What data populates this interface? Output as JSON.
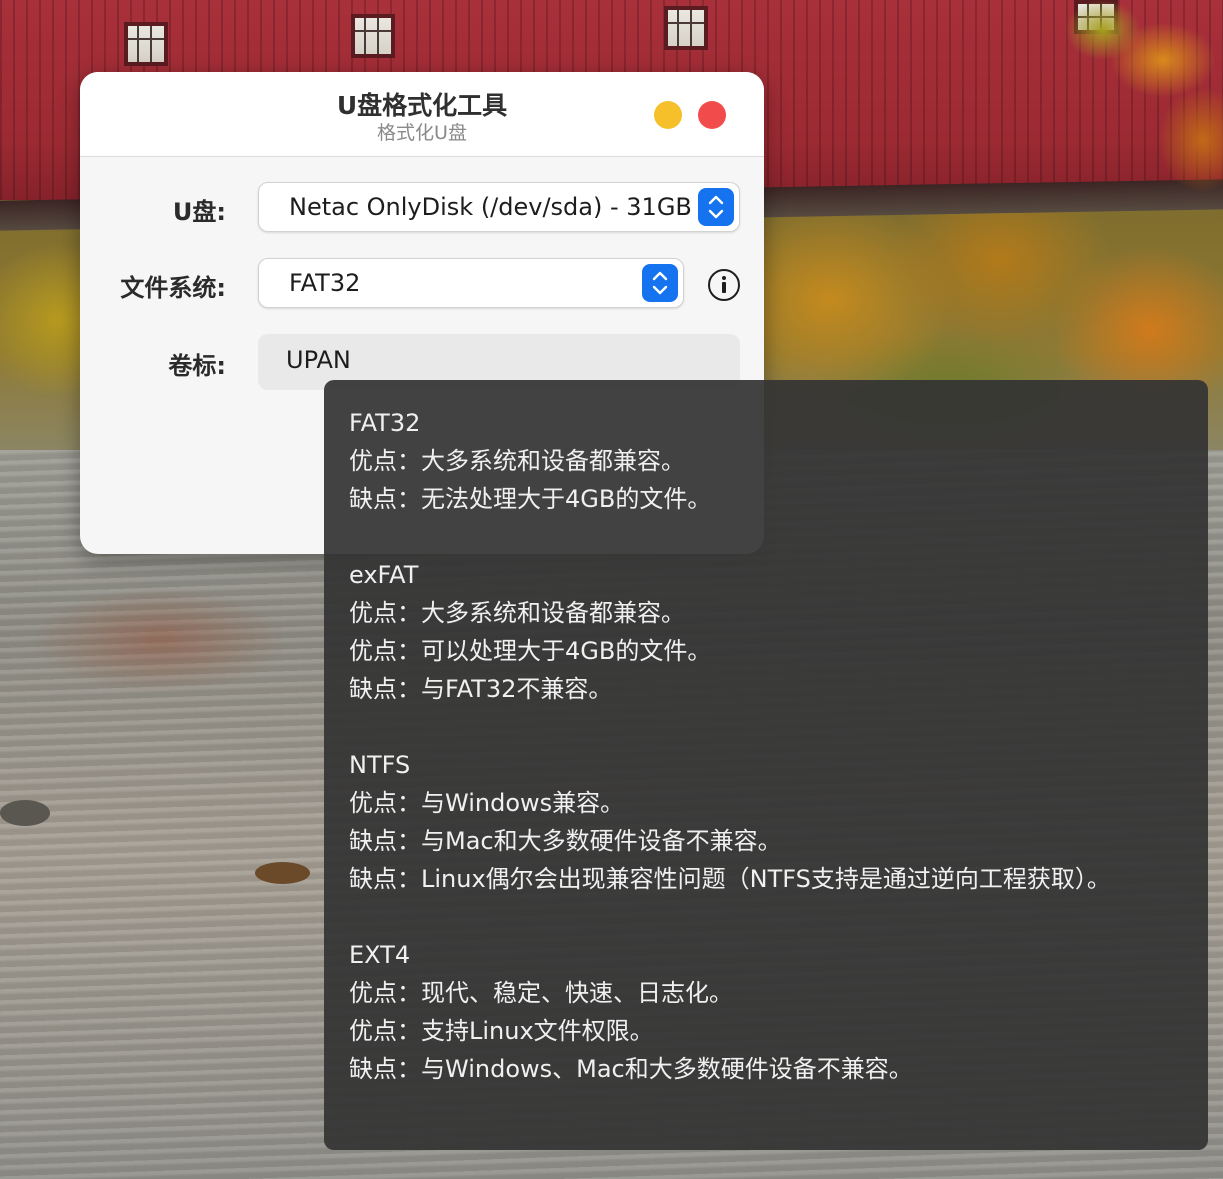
{
  "window": {
    "title": "U盘格式化工具",
    "subtitle": "格式化U盘",
    "controls": {
      "minimize_color": "#f5c02a",
      "close_color": "#f24b4b"
    }
  },
  "form": {
    "device": {
      "label": "U盘:",
      "value": "Netac OnlyDisk (/dev/sda) - 31GB"
    },
    "filesystem": {
      "label": "文件系统:",
      "value": "FAT32"
    },
    "volume": {
      "label": "卷标:",
      "value": "UPAN"
    }
  },
  "accent_color": "#1573f0",
  "tooltip": {
    "filesystems": [
      {
        "name": "FAT32",
        "lines": [
          "优点：大多系统和设备都兼容。",
          "缺点：无法处理大于4GB的文件。"
        ]
      },
      {
        "name": "exFAT",
        "lines": [
          "优点：大多系统和设备都兼容。",
          "优点：可以处理大于4GB的文件。",
          "缺点：与FAT32不兼容。"
        ]
      },
      {
        "name": "NTFS",
        "lines": [
          "优点：与Windows兼容。",
          "缺点：与Mac和大多数硬件设备不兼容。",
          "缺点：Linux偶尔会出现兼容性问题（NTFS支持是通过逆向工程获取）。"
        ]
      },
      {
        "name": "EXT4",
        "lines": [
          "优点：现代、稳定、快速、日志化。",
          "优点：支持Linux文件权限。",
          "缺点：与Windows、Mac和大多数硬件设备不兼容。"
        ]
      }
    ]
  }
}
